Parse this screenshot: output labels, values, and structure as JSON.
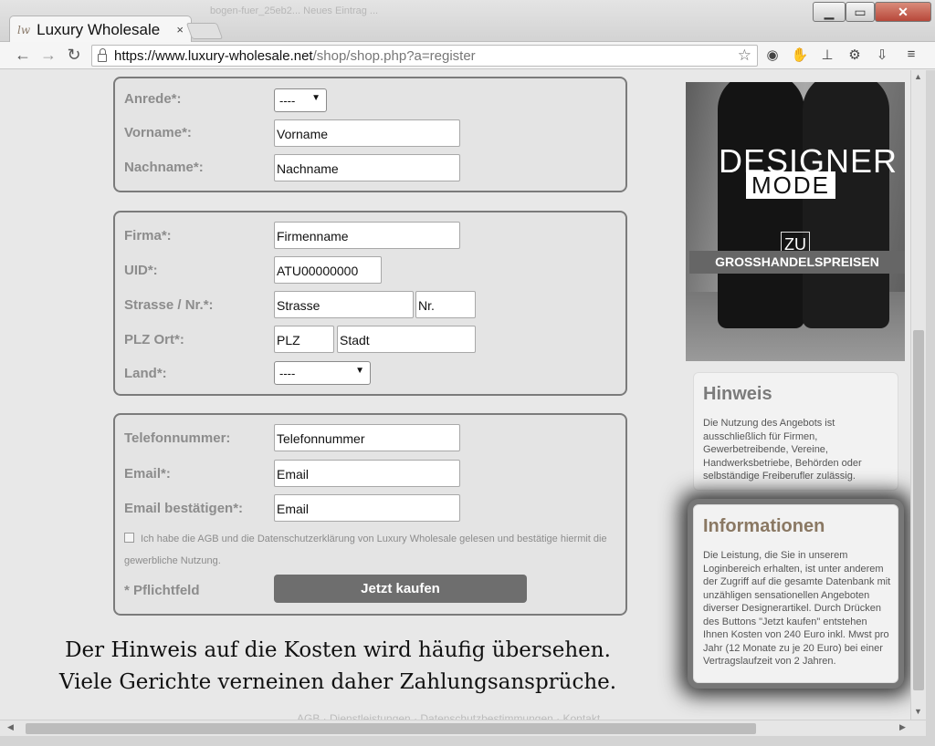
{
  "browser": {
    "tab_title": "Luxury Wholesale",
    "tab_close": "×",
    "tab_favicon": "lw-favicon",
    "background_tabs": "bogen-fuer_25eb2...   Neues Eintrag ...",
    "url_host": "https://www.luxury-wholesale.net",
    "url_path": "/shop/shop.php?a=register",
    "window_controls": {
      "minimize": "▁",
      "maximize": "▭",
      "close": "✕"
    },
    "nav": {
      "back": "←",
      "forward": "→",
      "reload": "↻"
    },
    "extensions": [
      "◉",
      "✋",
      "⊥",
      "⚙",
      "⇩",
      "≡"
    ]
  },
  "form": {
    "personal": {
      "anrede_label": "Anrede*:",
      "anrede_value": "----",
      "vorname_label": "Vorname*:",
      "vorname_value": "Vorname",
      "nachname_label": "Nachname*:",
      "nachname_value": "Nachname"
    },
    "company": {
      "firma_label": "Firma*:",
      "firma_value": "Firmenname",
      "uid_label": "UID*:",
      "uid_value": "ATU00000000",
      "strasse_label": "Strasse / Nr.*:",
      "strasse_value": "Strasse",
      "nr_value": "Nr.",
      "plz_ort_label": "PLZ Ort*:",
      "plz_value": "PLZ",
      "stadt_value": "Stadt",
      "land_label": "Land*:",
      "land_value": "----"
    },
    "contact": {
      "telefon_label": "Telefonnummer:",
      "telefon_value": "Telefonnummer",
      "email_label": "Email*:",
      "email_value": "Email",
      "email_confirm_label": "Email bestätigen*:",
      "email_confirm_value": "Email",
      "agb_text": "Ich habe die AGB und die Datenschutzerklärung von Luxury Wholesale gelesen und bestätige hiermit die gewerbliche Nutzung.",
      "required_note": "* Pflichtfeld",
      "submit_label": "Jetzt kaufen"
    }
  },
  "caption": {
    "line1": "Der Hinweis auf die Kosten wird häufig übersehen.",
    "line2": "Viele Gerichte verneinen daher Zahlungsansprüche."
  },
  "footer_links": "AGB · Dienstleistungen · Datenschutzbestimmungen · Kontakt",
  "banner": {
    "designer": "DESIGNER",
    "mode": "MODE",
    "zu": "ZU",
    "grosshandel": "GROSSHANDELSPREISEN"
  },
  "sidebar": {
    "hinweis_title": "Hinweis",
    "hinweis_text": "Die Nutzung des Angebots ist ausschließlich für Firmen, Gewerbetreibende, Vereine, Handwerksbetriebe, Behörden oder selbständige Freiberufler zulässig.",
    "info_title": "Informationen",
    "info_text": "Die Leistung, die Sie in unserem Loginbereich erhalten, ist unter anderem der Zugriff auf die gesamte Datenbank mit unzähligen sensationellen Angeboten diverser Designerartikel. Durch Drücken des Buttons \"Jetzt kaufen\" entstehen Ihnen Kosten von 240 Euro inkl. Mwst pro Jahr (12 Monate zu je 20 Euro) bei einer Vertragslaufzeit von 2 Jahren."
  }
}
